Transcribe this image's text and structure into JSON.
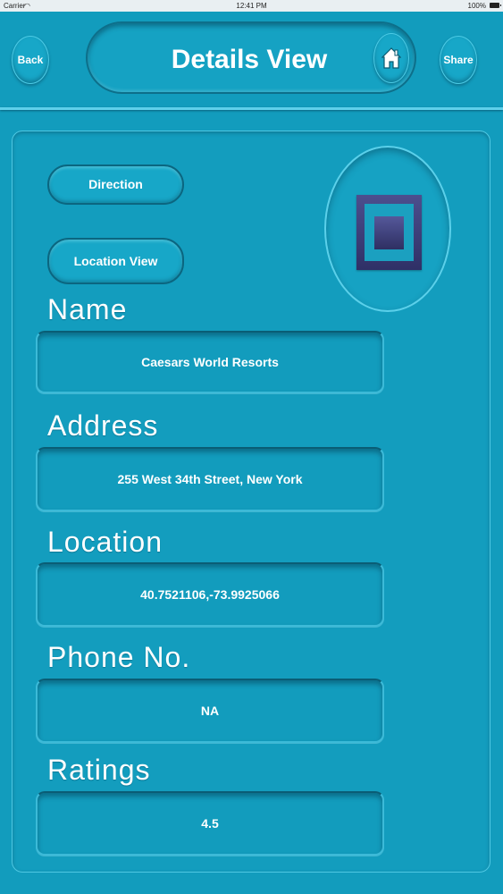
{
  "status_bar": {
    "carrier": "Carrier",
    "time": "12:41 PM",
    "battery": "100%"
  },
  "header": {
    "back_label": "Back",
    "title": "Details View",
    "share_label": "Share"
  },
  "actions": {
    "direction_label": "Direction",
    "location_view_label": "Location View"
  },
  "fields": {
    "name": {
      "label": "Name",
      "value": "Caesars World Resorts"
    },
    "address": {
      "label": "Address",
      "value": "255 West 34th Street, New York"
    },
    "location": {
      "label": "Location",
      "value": "40.7521106,-73.9925066"
    },
    "phone": {
      "label": "Phone No.",
      "value": "NA"
    },
    "ratings": {
      "label": "Ratings",
      "value": "4.5"
    }
  },
  "icons": [
    "wifi-icon",
    "battery-icon",
    "home-icon",
    "image-placeholder-icon"
  ],
  "colors": {
    "background": "#129cbd",
    "accent_light": "#5fd0ea",
    "border_dark": "#0b6680",
    "placeholder": "#2f3066"
  }
}
